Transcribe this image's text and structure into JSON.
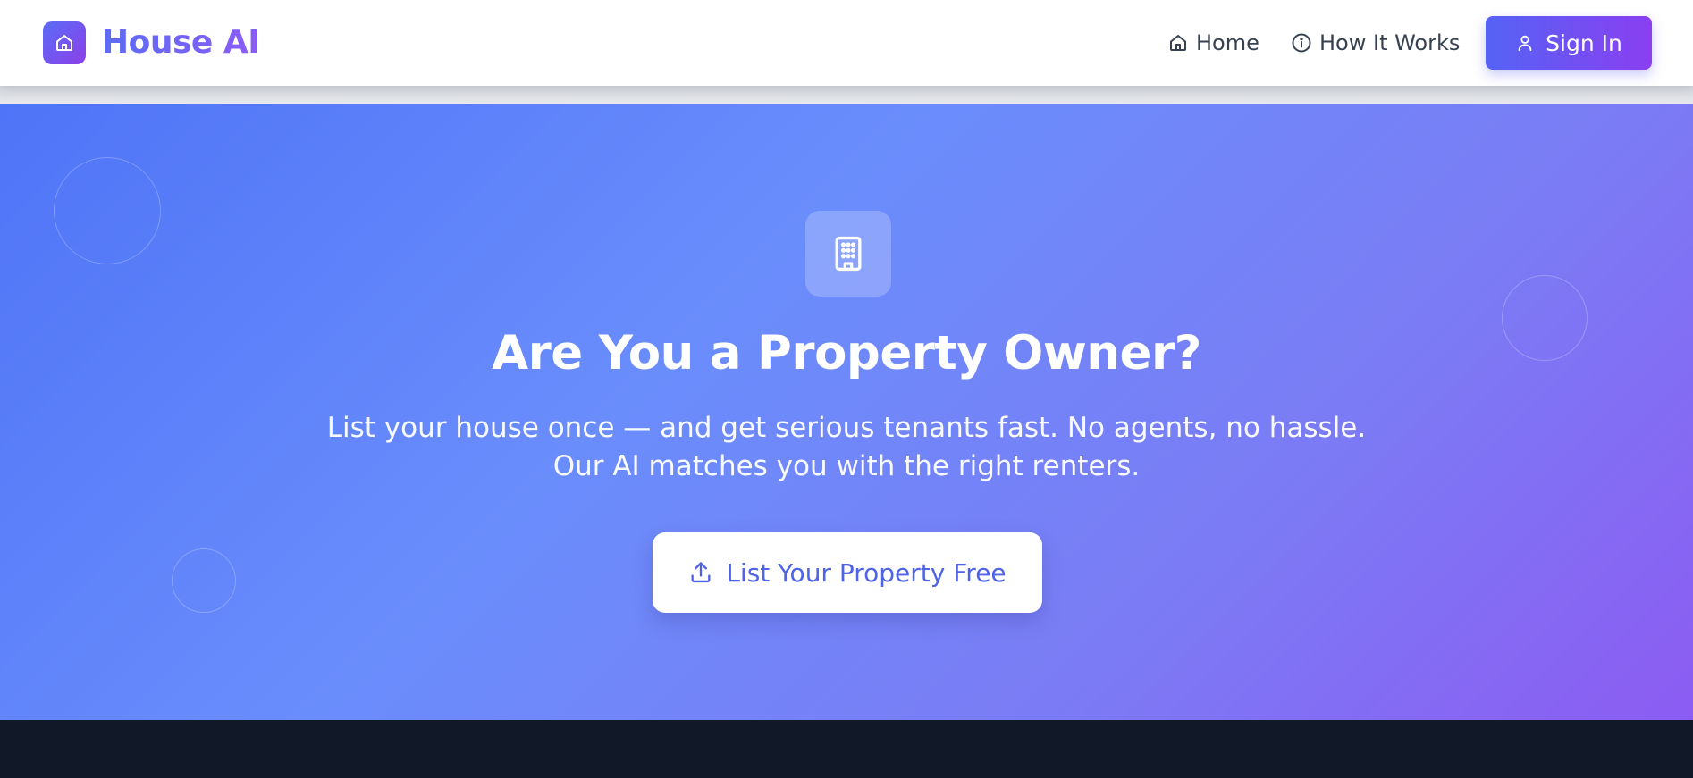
{
  "brand": {
    "name": "House AI",
    "gradient_start": "#5b6cf6",
    "gradient_end": "#8b3fe8",
    "icon": "home-icon"
  },
  "nav": {
    "items": [
      {
        "label": "Home",
        "icon": "home-icon"
      },
      {
        "label": "How It Works",
        "icon": "info-icon"
      }
    ],
    "sign_in": {
      "label": "Sign In",
      "icon": "user-icon"
    }
  },
  "hero": {
    "icon": "building-icon",
    "title": "Are You a Property Owner?",
    "subtitle_line1": "List your house once — and get serious tenants fast. No agents, no hassle.",
    "subtitle_line2": "Our AI matches you with the right renters.",
    "cta": {
      "label": "List Your Property Free",
      "icon": "upload-icon"
    },
    "gradient_start": "#4f74f7",
    "gradient_end": "#8c5cf2"
  },
  "footer": {
    "background": "#111827"
  }
}
